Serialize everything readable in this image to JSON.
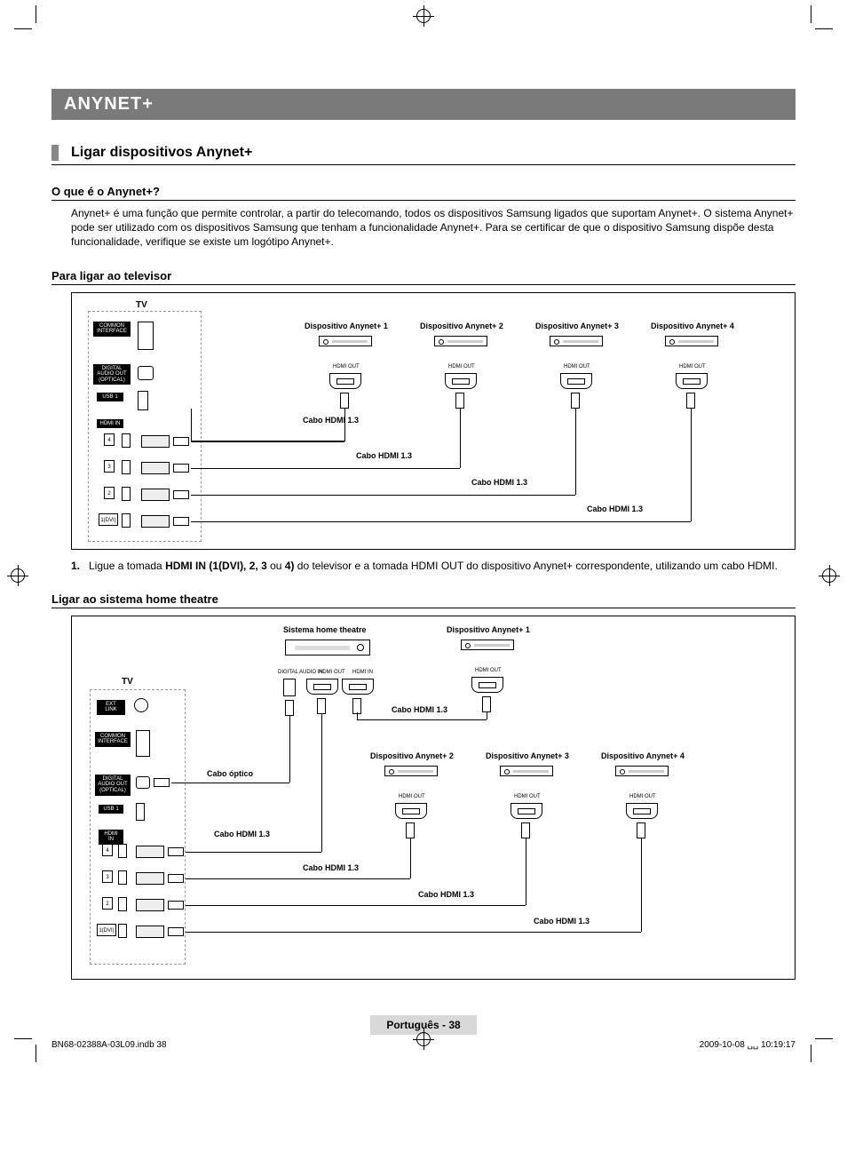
{
  "banner": "ANYNET+",
  "section_heading": "Ligar dispositivos Anynet+",
  "subhead1": "O que é o Anynet+?",
  "para1": "Anynet+ é uma função que permite controlar, a partir do telecomando, todos os dispositivos Samsung ligados que suportam Anynet+. O sistema Anynet+ pode ser utilizado com os dispositivos Samsung que tenham a funcionalidade Anynet+. Para se certificar de que o dispositivo Samsung dispõe desta funcionalidade, verifique se existe um logótipo Anynet+.",
  "subhead2": "Para ligar ao televisor",
  "diagram1": {
    "tv": "TV",
    "port_common": "COMMON INTERFACE",
    "port_audio": "DIGITAL AUDIO OUT (OPTICAL)",
    "port_usb": "USB 1",
    "port_hdmi": "HDMI IN",
    "hdmi_nums": [
      "4",
      "3",
      "2",
      "1(DVI)"
    ],
    "devices": [
      "Dispositivo Anynet+ 1",
      "Dispositivo Anynet+ 2",
      "Dispositivo Anynet+ 3",
      "Dispositivo Anynet+ 4"
    ],
    "hdmi_out": "HDMI OUT",
    "cable": "Cabo HDMI 1.3"
  },
  "step1_num": "1.",
  "step1_a": "Ligue a tomada ",
  "step1_b": "HDMI IN (1(DVI), 2, 3",
  "step1_c": " ou ",
  "step1_d": "4)",
  "step1_e": " do televisor e a tomada HDMI OUT do dispositivo Anynet+ correspondente, utilizando um cabo HDMI.",
  "subhead3": "Ligar ao sistema home theatre",
  "diagram2": {
    "tv": "TV",
    "ht_label": "Sistema home theatre",
    "port_ext": "EXT LINK",
    "port_common": "COMMON INTERFACE",
    "port_audio": "DIGITAL AUDIO OUT (OPTICAL)",
    "port_usb": "USB 1",
    "port_hdmi": "HDMI IN",
    "hdmi_nums": [
      "4",
      "3",
      "2",
      "1(DVI)"
    ],
    "ht_ports": {
      "audio": "DIGITAL AUDIO IN",
      "out": "HDMI OUT",
      "in": "HDMI IN"
    },
    "devices": [
      "Dispositivo Anynet+ 1",
      "Dispositivo Anynet+ 2",
      "Dispositivo Anynet+ 3",
      "Dispositivo Anynet+ 4"
    ],
    "hdmi_out": "HDMI OUT",
    "optical": "Cabo óptico",
    "cable": "Cabo HDMI 1.3"
  },
  "footer": "Português - 38",
  "meta_left": "BN68-02388A-03L09.indb   38",
  "meta_right": "2009-10-08   ␣␣ 10:19:17"
}
